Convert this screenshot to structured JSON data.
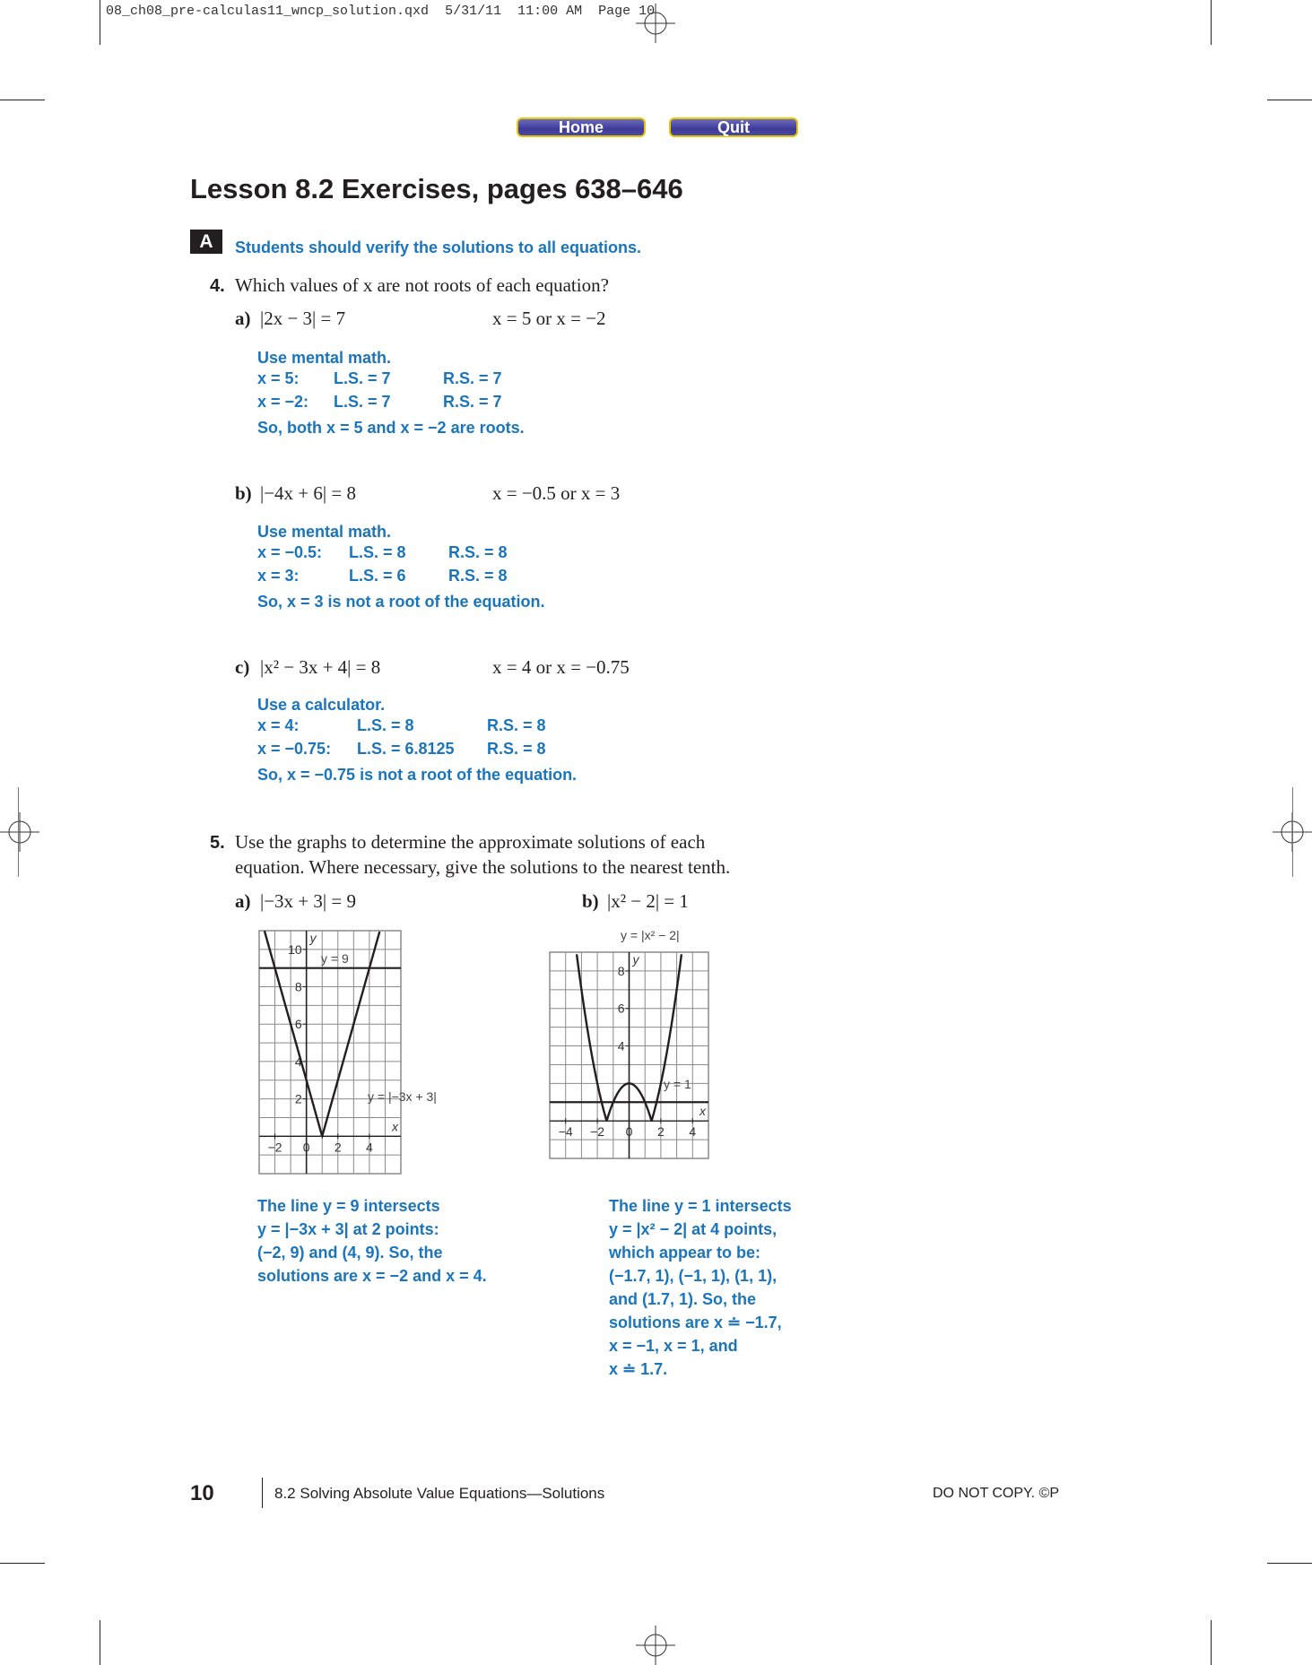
{
  "slug": {
    "filename": "08_ch08_pre-calculas11_wncp_solution.qxd",
    "date": "5/31/11",
    "time": "11:00 AM",
    "page": "Page 10"
  },
  "nav": {
    "home_label": "Home",
    "quit_label": "Quit"
  },
  "title": "Lesson 8.2 Exercises, pages 638–646",
  "section": {
    "letter": "A",
    "note": "Students should verify the solutions to all equations."
  },
  "q4": {
    "number": "4.",
    "prompt": "Which values of x are not roots of each equation?",
    "parts": [
      {
        "label": "a)",
        "equation": "|2x − 3| = 7",
        "candidates": "x = 5 or x = −2",
        "method": "Use mental math.",
        "rows": [
          {
            "x": "x = 5:",
            "ls": "L.S. = 7",
            "rs": "R.S. = 7"
          },
          {
            "x": "x = −2:",
            "ls": "L.S. = 7",
            "rs": "R.S. = 7"
          }
        ],
        "conclusion": "So, both x = 5 and x = −2 are roots."
      },
      {
        "label": "b)",
        "equation": "|−4x + 6| = 8",
        "candidates": "x = −0.5 or x = 3",
        "method": "Use mental math.",
        "rows": [
          {
            "x": "x = −0.5:",
            "ls": "L.S. = 8",
            "rs": "R.S. = 8"
          },
          {
            "x": "x = 3:",
            "ls": "L.S. = 6",
            "rs": "R.S. = 8"
          }
        ],
        "conclusion": "So, x = 3 is not a root of the equation."
      },
      {
        "label": "c)",
        "equation": "|x² − 3x + 4| = 8",
        "candidates": "x = 4 or x = −0.75",
        "method": "Use a calculator.",
        "rows": [
          {
            "x": "x = 4:",
            "ls": "L.S. = 8",
            "rs": "R.S. = 8"
          },
          {
            "x": "x = −0.75:",
            "ls": "L.S. = 6.8125",
            "rs": "R.S. = 8"
          }
        ],
        "conclusion": "So, x = −0.75 is not a root of the equation."
      }
    ]
  },
  "q5": {
    "number": "5.",
    "prompt_line1": "Use the graphs to determine the approximate solutions of each",
    "prompt_line2": "equation. Where necessary, give the solutions to the nearest tenth.",
    "part_a": {
      "label": "a)",
      "equation": "|−3x + 3| = 9",
      "answer": [
        "The line y = 9 intersects",
        "y = |−3x + 3| at 2 points:",
        "(−2, 9) and (4, 9). So, the",
        "solutions are x = −2 and x = 4."
      ]
    },
    "part_b": {
      "label": "b)",
      "equation": "|x² − 2| = 1",
      "answer": [
        "The line y = 1 intersects",
        "y = |x² − 2| at 4 points,",
        "which appear to be:",
        "(−1.7, 1), (−1, 1), (1, 1),",
        "and (1.7, 1). So, the",
        "solutions are x ≐ −1.7,",
        "x = −1, x = 1, and",
        "x ≐ 1.7."
      ]
    }
  },
  "chart_data": [
    {
      "type": "line",
      "title": "",
      "xlabel": "x",
      "ylabel": "y",
      "xlim": [
        -3,
        6
      ],
      "ylim": [
        -2,
        11
      ],
      "grid": true,
      "x_ticks": [
        -2,
        0,
        2,
        4
      ],
      "y_ticks": [
        2,
        4,
        6,
        8,
        10
      ],
      "series": [
        {
          "name": "y = |−3x + 3|",
          "function": "abs(-3x+3)",
          "x": [
            -2.67,
            1,
            4.67
          ],
          "y": [
            11,
            0,
            11
          ]
        },
        {
          "name": "y = 9",
          "function": "9",
          "x": [
            -3,
            6
          ],
          "y": [
            9,
            9
          ]
        }
      ],
      "annotations": [
        "y = 9",
        "y = |−3x + 3|"
      ]
    },
    {
      "type": "line",
      "title": "y = |x² − 2|",
      "xlabel": "x",
      "ylabel": "y",
      "xlim": [
        -5,
        5
      ],
      "ylim": [
        -2,
        9
      ],
      "grid": true,
      "x_ticks": [
        -4,
        -2,
        0,
        2,
        4
      ],
      "y_ticks": [
        4,
        6,
        8
      ],
      "series": [
        {
          "name": "y = |x² − 2|",
          "function": "abs(x^2-2)",
          "x": [
            -3.32,
            -2,
            -1.41,
            0,
            1.41,
            2,
            3.32
          ],
          "y": [
            9,
            2,
            0,
            2,
            0,
            2,
            9
          ]
        },
        {
          "name": "y = 1",
          "function": "1",
          "x": [
            -5,
            5
          ],
          "y": [
            1,
            1
          ]
        }
      ],
      "annotations": [
        "y = |x² − 2|",
        "y = 1"
      ]
    }
  ],
  "footer": {
    "page_number": "10",
    "section_title": "8.2 Solving Absolute Value Equations—Solutions",
    "notice": "DO NOT COPY.  ©P"
  }
}
